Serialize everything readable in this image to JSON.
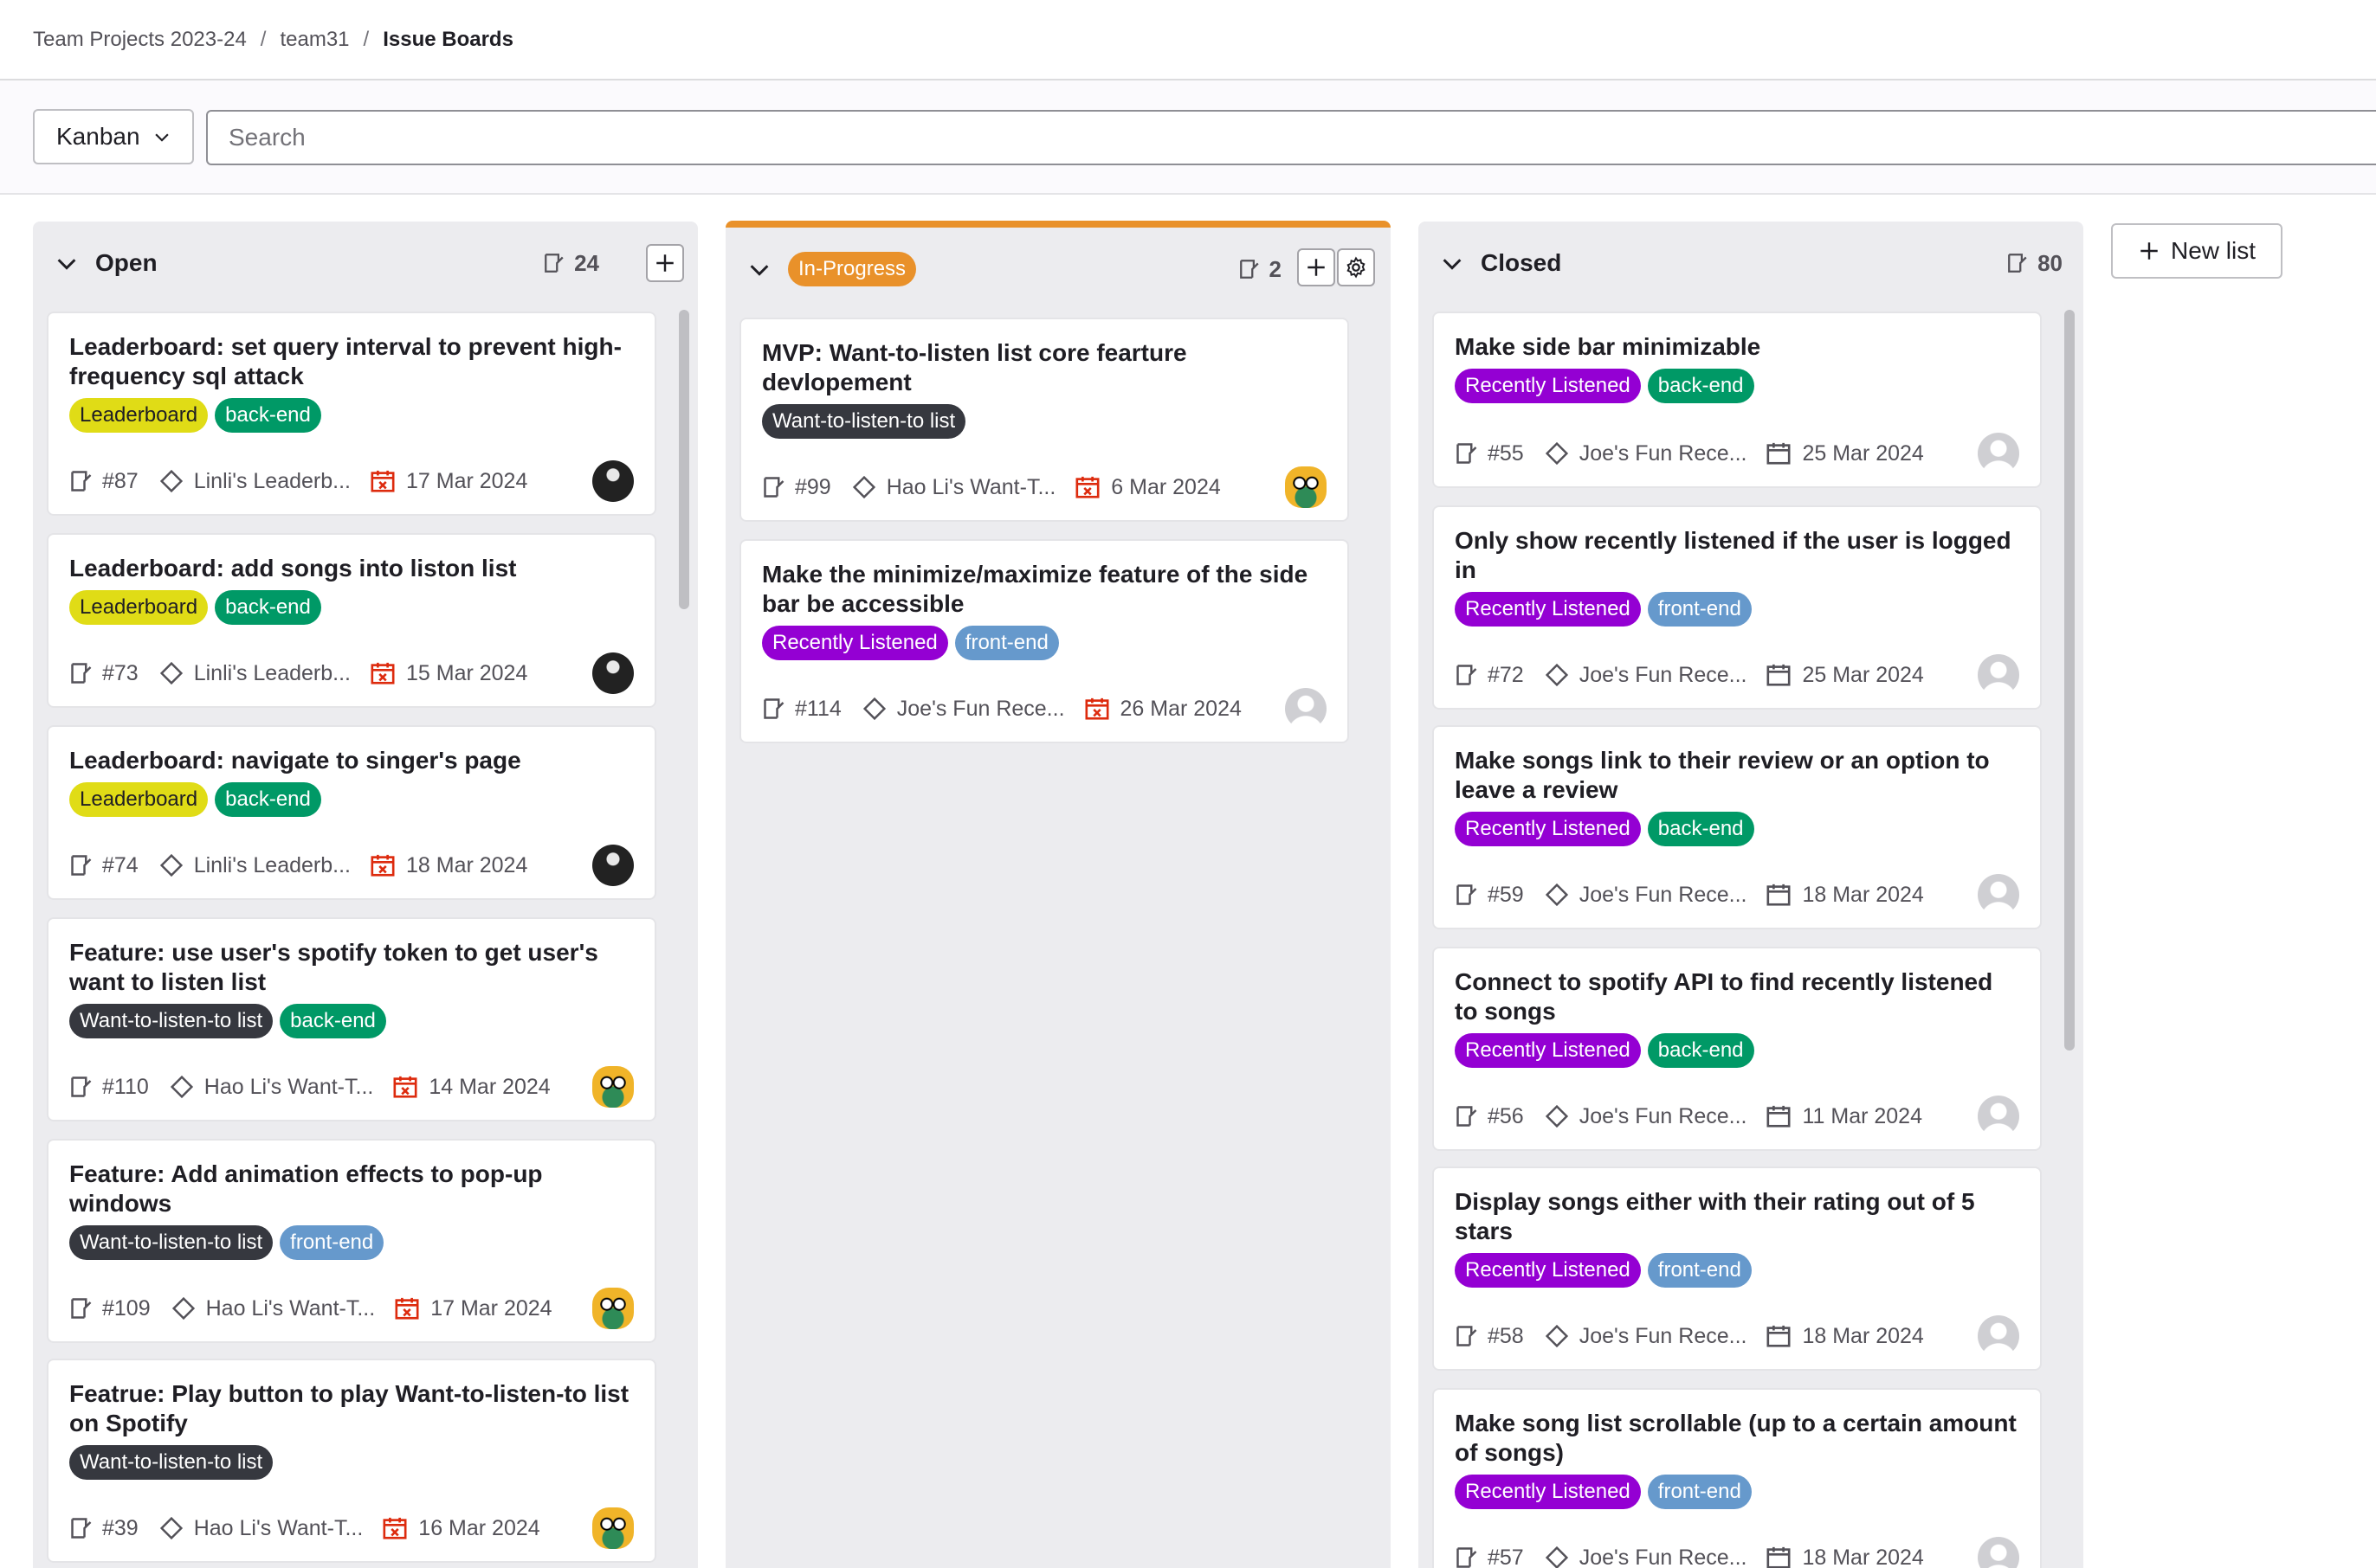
{
  "breadcrumb": {
    "group": "Team Projects 2023-24",
    "project": "team31",
    "current": "Issue Boards",
    "separator": "/"
  },
  "filter": {
    "board": "Kanban",
    "search_placeholder": "Search"
  },
  "new_list_label": "New list",
  "colors": {
    "leaderboard": "#e0dc16",
    "backend": "#009966",
    "frontend": "#6699cc",
    "recently": "#9400d3",
    "want": "#36383f",
    "inprogress": "#e9912a"
  },
  "lists": [
    {
      "title": "Open",
      "count": "24",
      "cards": [
        {
          "title": "Leaderboard: set query interval to prevent high-frequency sql attack",
          "labels": [
            "Leaderboard",
            "back-end"
          ],
          "number": "#87",
          "milestone": "Linli's Leaderb...",
          "date": "17 Mar 2024",
          "overdue": true,
          "avatar": "dark"
        },
        {
          "title": "Leaderboard: add songs into liston list",
          "labels": [
            "Leaderboard",
            "back-end"
          ],
          "number": "#73",
          "milestone": "Linli's Leaderb...",
          "date": "15 Mar 2024",
          "overdue": true,
          "avatar": "dark"
        },
        {
          "title": "Leaderboard: navigate to singer's page",
          "labels": [
            "Leaderboard",
            "back-end"
          ],
          "number": "#74",
          "milestone": "Linli's Leaderb...",
          "date": "18 Mar 2024",
          "overdue": true,
          "avatar": "dark"
        },
        {
          "title": "Feature: use user's spotify token to get user's want to listen list",
          "labels": [
            "Want-to-listen-to list",
            "back-end"
          ],
          "number": "#110",
          "milestone": "Hao Li's Want-T...",
          "date": "14 Mar 2024",
          "overdue": true,
          "avatar": "owl"
        },
        {
          "title": "Feature: Add animation effects to pop-up windows",
          "labels": [
            "Want-to-listen-to list",
            "front-end"
          ],
          "number": "#109",
          "milestone": "Hao Li's Want-T...",
          "date": "17 Mar 2024",
          "overdue": true,
          "avatar": "owl"
        },
        {
          "title": "Featrue: Play button to play Want-to-listen-to list on Spotify",
          "labels": [
            "Want-to-listen-to list"
          ],
          "number": "#39",
          "milestone": "Hao Li's Want-T...",
          "date": "16 Mar 2024",
          "overdue": true,
          "avatar": "owl"
        }
      ]
    },
    {
      "title": "In-Progress",
      "count": "2",
      "cards": [
        {
          "title": "MVP: Want-to-listen list core fearture devlopement",
          "labels": [
            "Want-to-listen-to list"
          ],
          "number": "#99",
          "milestone": "Hao Li's Want-T...",
          "date": "6 Mar 2024",
          "overdue": true,
          "avatar": "owl"
        },
        {
          "title": "Make the minimize/maximize feature of the side bar be accessible",
          "labels": [
            "Recently Listened",
            "front-end"
          ],
          "number": "#114",
          "milestone": "Joe's Fun Rece...",
          "date": "26 Mar 2024",
          "overdue": true,
          "avatar": "grey"
        }
      ]
    },
    {
      "title": "Closed",
      "count": "80",
      "cards": [
        {
          "title": "Make side bar minimizable",
          "labels": [
            "Recently Listened",
            "back-end"
          ],
          "number": "#55",
          "milestone": "Joe's Fun Rece...",
          "date": "25 Mar 2024",
          "overdue": false,
          "avatar": "grey"
        },
        {
          "title": "Only show recently listened if the user is logged in",
          "labels": [
            "Recently Listened",
            "front-end"
          ],
          "number": "#72",
          "milestone": "Joe's Fun Rece...",
          "date": "25 Mar 2024",
          "overdue": false,
          "avatar": "grey"
        },
        {
          "title": "Make songs link to their review or an option to leave a review",
          "labels": [
            "Recently Listened",
            "back-end"
          ],
          "number": "#59",
          "milestone": "Joe's Fun Rece...",
          "date": "18 Mar 2024",
          "overdue": false,
          "avatar": "grey"
        },
        {
          "title": "Connect to spotify API to find recently listened to songs",
          "labels": [
            "Recently Listened",
            "back-end"
          ],
          "number": "#56",
          "milestone": "Joe's Fun Rece...",
          "date": "11 Mar 2024",
          "overdue": false,
          "avatar": "grey"
        },
        {
          "title": "Display songs either with their rating out of 5 stars",
          "labels": [
            "Recently Listened",
            "front-end"
          ],
          "number": "#58",
          "milestone": "Joe's Fun Rece...",
          "date": "18 Mar 2024",
          "overdue": false,
          "avatar": "grey"
        },
        {
          "title": "Make song list scrollable (up to a certain amount of songs)",
          "labels": [
            "Recently Listened",
            "front-end"
          ],
          "number": "#57",
          "milestone": "Joe's Fun Rece...",
          "date": "18 Mar 2024",
          "overdue": false,
          "avatar": "grey"
        }
      ]
    }
  ]
}
